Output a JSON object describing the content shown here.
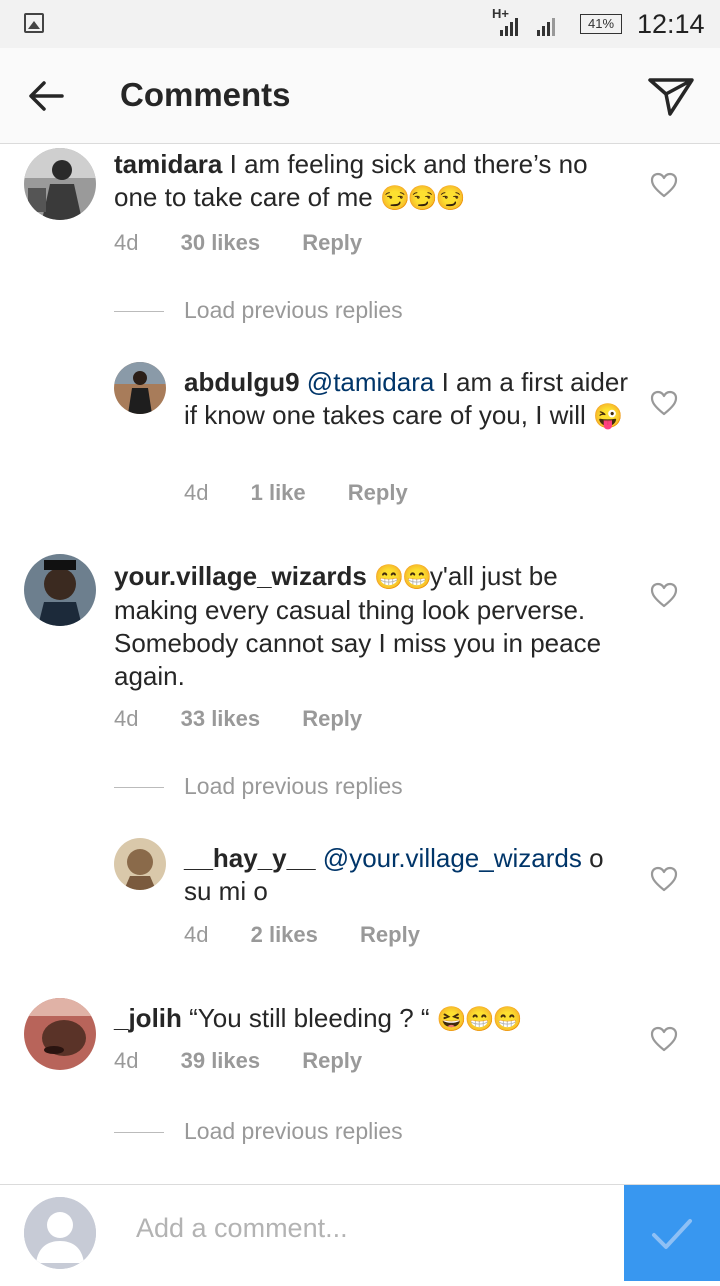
{
  "status": {
    "network": "H+",
    "battery": "41%",
    "time": "12:14"
  },
  "header": {
    "title": "Comments"
  },
  "comments": [
    {
      "user": "tamidara",
      "text": "I am feeling sick and there’s no one to take care of me",
      "emoji": "😏😏😏",
      "time": "4d",
      "likes": "30 likes",
      "reply": "Reply",
      "load_replies": "Load previous replies",
      "replies": [
        {
          "user": "abdulgu9",
          "mention": "@tamidara",
          "text": "I am a first aider if know one takes care of you, I will",
          "emoji": "😜",
          "time": "4d",
          "likes": "1 like",
          "reply": "Reply"
        }
      ]
    },
    {
      "user": "your.village_wizards",
      "emoji_lead": "😁😁",
      "text": "y'all just be making every casual thing look perverse. Somebody cannot say I miss you in peace again.",
      "time": "4d",
      "likes": "33 likes",
      "reply": "Reply",
      "load_replies": "Load previous replies",
      "replies": [
        {
          "user": "__hay_y__",
          "mention": "@your.village_wizards",
          "text": "o su mi o",
          "time": "4d",
          "likes": "2 likes",
          "reply": "Reply"
        }
      ]
    },
    {
      "user": "_jolih",
      "text": "“You still bleeding ? “",
      "emoji": "😆😁😁",
      "time": "4d",
      "likes": "39 likes",
      "reply": "Reply",
      "load_replies": "Load previous replies"
    }
  ],
  "composer": {
    "placeholder": "Add a comment..."
  },
  "colors": {
    "accent": "#3897f0",
    "mention": "#003569",
    "muted": "#999999"
  }
}
